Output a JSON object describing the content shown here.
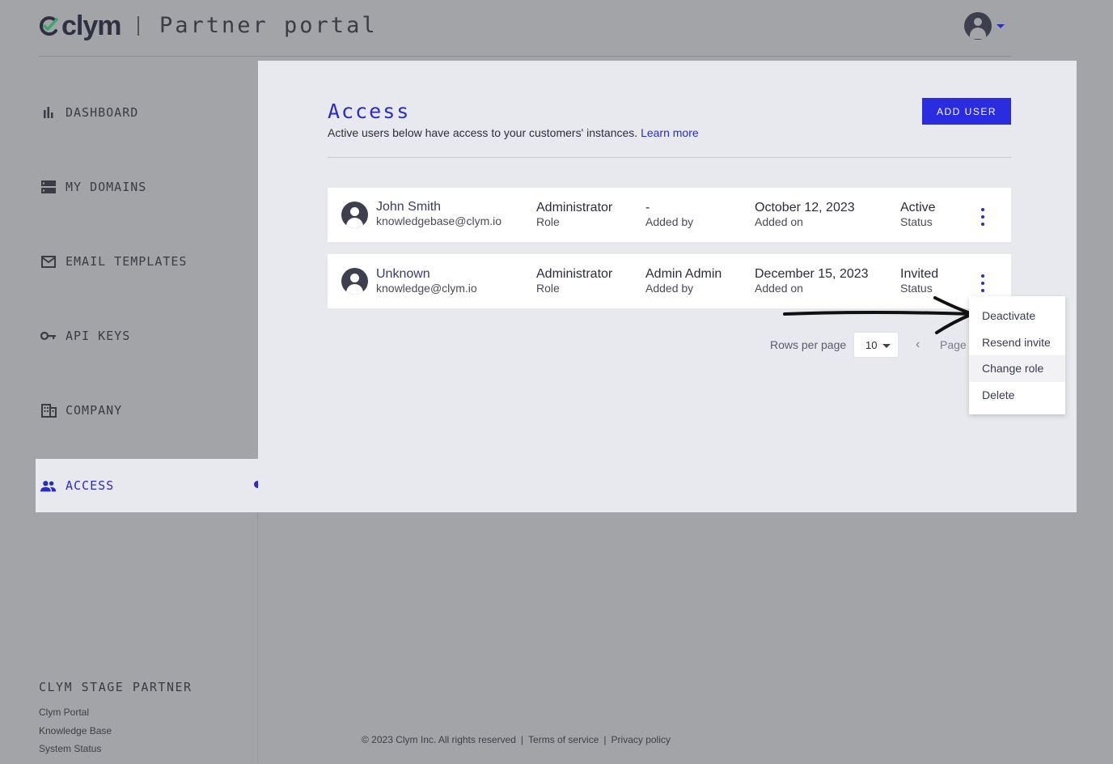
{
  "header": {
    "logo_text": "clym",
    "portal_title": "Partner portal"
  },
  "sidebar": {
    "items": [
      {
        "label": "DASHBOARD",
        "icon": "bar-chart-icon"
      },
      {
        "label": "MY DOMAINS",
        "icon": "server-icon"
      },
      {
        "label": "EMAIL TEMPLATES",
        "icon": "mail-icon"
      },
      {
        "label": "API KEYS",
        "icon": "key-icon"
      },
      {
        "label": "COMPANY",
        "icon": "building-icon"
      },
      {
        "label": "ACCESS",
        "icon": "people-icon",
        "active": true
      }
    ],
    "partner_name": "CLYM STAGE PARTNER",
    "links": [
      "Clym Portal",
      "Knowledge Base",
      "System Status"
    ]
  },
  "main": {
    "title": "Access",
    "subtitle": "Active users below have access to your customers' instances.",
    "learn_more": "Learn more",
    "add_user_label": "ADD USER",
    "users": [
      {
        "name": "John Smith",
        "email": "knowledgebase@clym.io",
        "role": "Administrator",
        "role_label": "Role",
        "added_by": "-",
        "added_by_label": "Added by",
        "added_on": "October 12, 2023",
        "added_on_label": "Added on",
        "status": "Active",
        "status_label": "Status"
      },
      {
        "name": "Unknown",
        "email": "knowledge@clym.io",
        "role": "Administrator",
        "role_label": "Role",
        "added_by": "Admin Admin",
        "added_by_label": "Added by",
        "added_on": "December 15, 2023",
        "added_on_label": "Added on",
        "status": "Invited",
        "status_label": "Status"
      }
    ],
    "pagination": {
      "rows_per_page_label": "Rows per page",
      "rows_per_page_value": "10",
      "page_label": "Page"
    }
  },
  "context_menu": {
    "items": [
      "Deactivate",
      "Resend invite",
      "Change role",
      "Delete"
    ],
    "highlighted": "Change role"
  },
  "footer": {
    "copyright": "© 2023 Clym Inc. All rights reserved",
    "terms": "Terms of service",
    "privacy": "Privacy policy"
  },
  "colors": {
    "accent": "#2b2cc4",
    "button": "#2b2ce0",
    "background": "#a3a4a7",
    "panel": "#e8e9ee"
  }
}
